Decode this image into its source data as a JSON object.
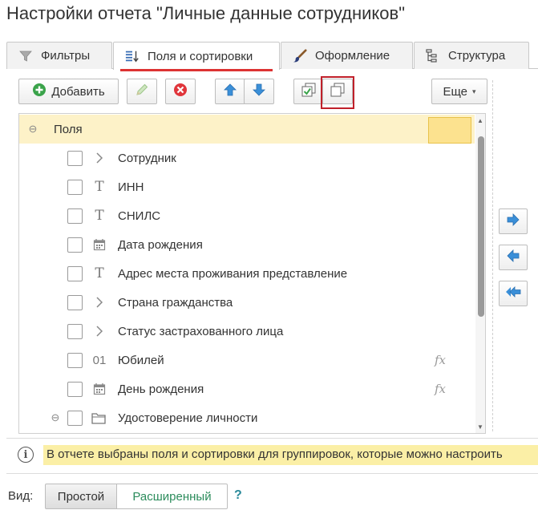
{
  "title": "Настройки отчета \"Личные данные сотрудников\"",
  "tabs": [
    {
      "label": "Фильтры",
      "icon": "filter-icon",
      "active": false
    },
    {
      "label": "Поля и сортировки",
      "icon": "fields-sort-icon",
      "active": true
    },
    {
      "label": "Оформление",
      "icon": "brush-icon",
      "active": false
    },
    {
      "label": "Структура",
      "icon": "structure-icon",
      "active": false
    }
  ],
  "toolbar": {
    "add_label": "Добавить",
    "more_label": "Еще",
    "icons": [
      "plus-circle-icon",
      "pencil-icon",
      "delete-icon",
      "arrow-up-icon",
      "arrow-down-icon",
      "check-all-icon",
      "uncheck-all-icon",
      "chevron-down-icon"
    ]
  },
  "tree": {
    "root_label": "Поля",
    "items": [
      {
        "label": "Сотрудник",
        "type": "chevron",
        "fx": ""
      },
      {
        "label": "ИНН",
        "type": "T",
        "fx": ""
      },
      {
        "label": "СНИЛС",
        "type": "T",
        "fx": ""
      },
      {
        "label": "Дата рождения",
        "type": "calendar",
        "fx": ""
      },
      {
        "label": "Адрес места проживания представление",
        "type": "T",
        "fx": ""
      },
      {
        "label": "Страна гражданства",
        "type": "chevron",
        "fx": ""
      },
      {
        "label": "Статус застрахованного лица",
        "type": "chevron",
        "fx": ""
      },
      {
        "label": "Юбилей",
        "type": "01",
        "fx": "fx"
      },
      {
        "label": "День рождения",
        "type": "calendar",
        "fx": "fx"
      },
      {
        "label": "Удостоверение личности",
        "type": "folder",
        "fx": ""
      }
    ]
  },
  "info": {
    "text": "В отчете выбраны поля и сортировки для группировок, которые можно настроить"
  },
  "view": {
    "label": "Вид:",
    "simple": "Простой",
    "extended": "Расширенный",
    "help": "?"
  },
  "colors": {
    "accent_red": "#c0202a",
    "highlight_row": "#fdf2c8",
    "info_bg": "#fbefa6",
    "arrow_blue": "#3a8fd8",
    "link_green": "#2c8c5c"
  }
}
